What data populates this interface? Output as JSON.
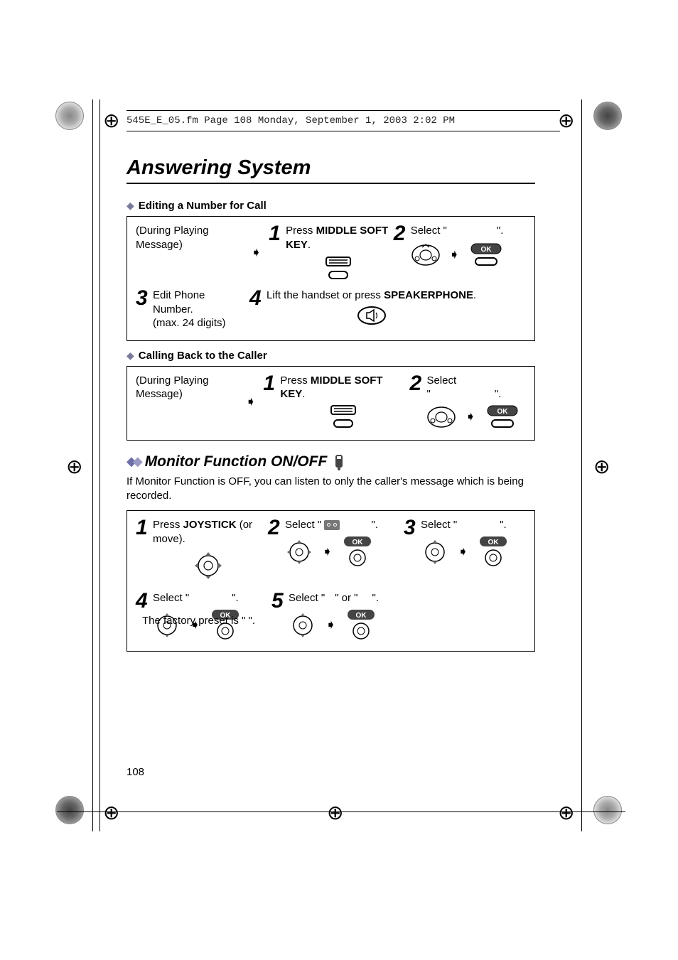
{
  "print_header": "545E_E_05.fm  Page 108  Monday, September 1, 2003  2:02 PM",
  "title": "Answering System",
  "sub1": "Editing a Number for Call",
  "sub2": "Calling Back to the Caller",
  "section2": "Monitor Function ON/OFF",
  "monitor_intro": "If Monitor Function is OFF, you can listen to only the caller's message which is being recorded.",
  "boxA": {
    "during": "(During Playing Message)",
    "s1_a": "Press ",
    "s1_b": "MIDDLE SOFT KEY",
    "s1_c": ".",
    "s2_a": "Select \"",
    "s2_b": "\".",
    "s3": "Edit Phone Number.\n(max. 24 digits)",
    "s4_a": "Lift the handset or press ",
    "s4_b": "SPEAKERPHONE",
    "s4_c": "."
  },
  "boxB": {
    "during": "(During Playing Message)",
    "s1_a": "Press ",
    "s1_b": "MIDDLE SOFT KEY",
    "s1_c": ".",
    "s2_a": "Select \"",
    "s2_b": "\"."
  },
  "boxC": {
    "s1_a": "Press ",
    "s1_b": "JOYSTICK",
    "s1_c": " (or move).",
    "s2_a": "Select \"",
    "s2_b": "\".",
    "s3_a": "Select \"",
    "s3_b": "\".",
    "s4_a": "Select \"",
    "s4_b": "\".",
    "s5_a": "Select \"",
    "s5_b": "\" or \"",
    "s5_c": "\"."
  },
  "factory_preset": "The factory preset is \"    \".",
  "ok_label": "OK",
  "page_number": "108"
}
